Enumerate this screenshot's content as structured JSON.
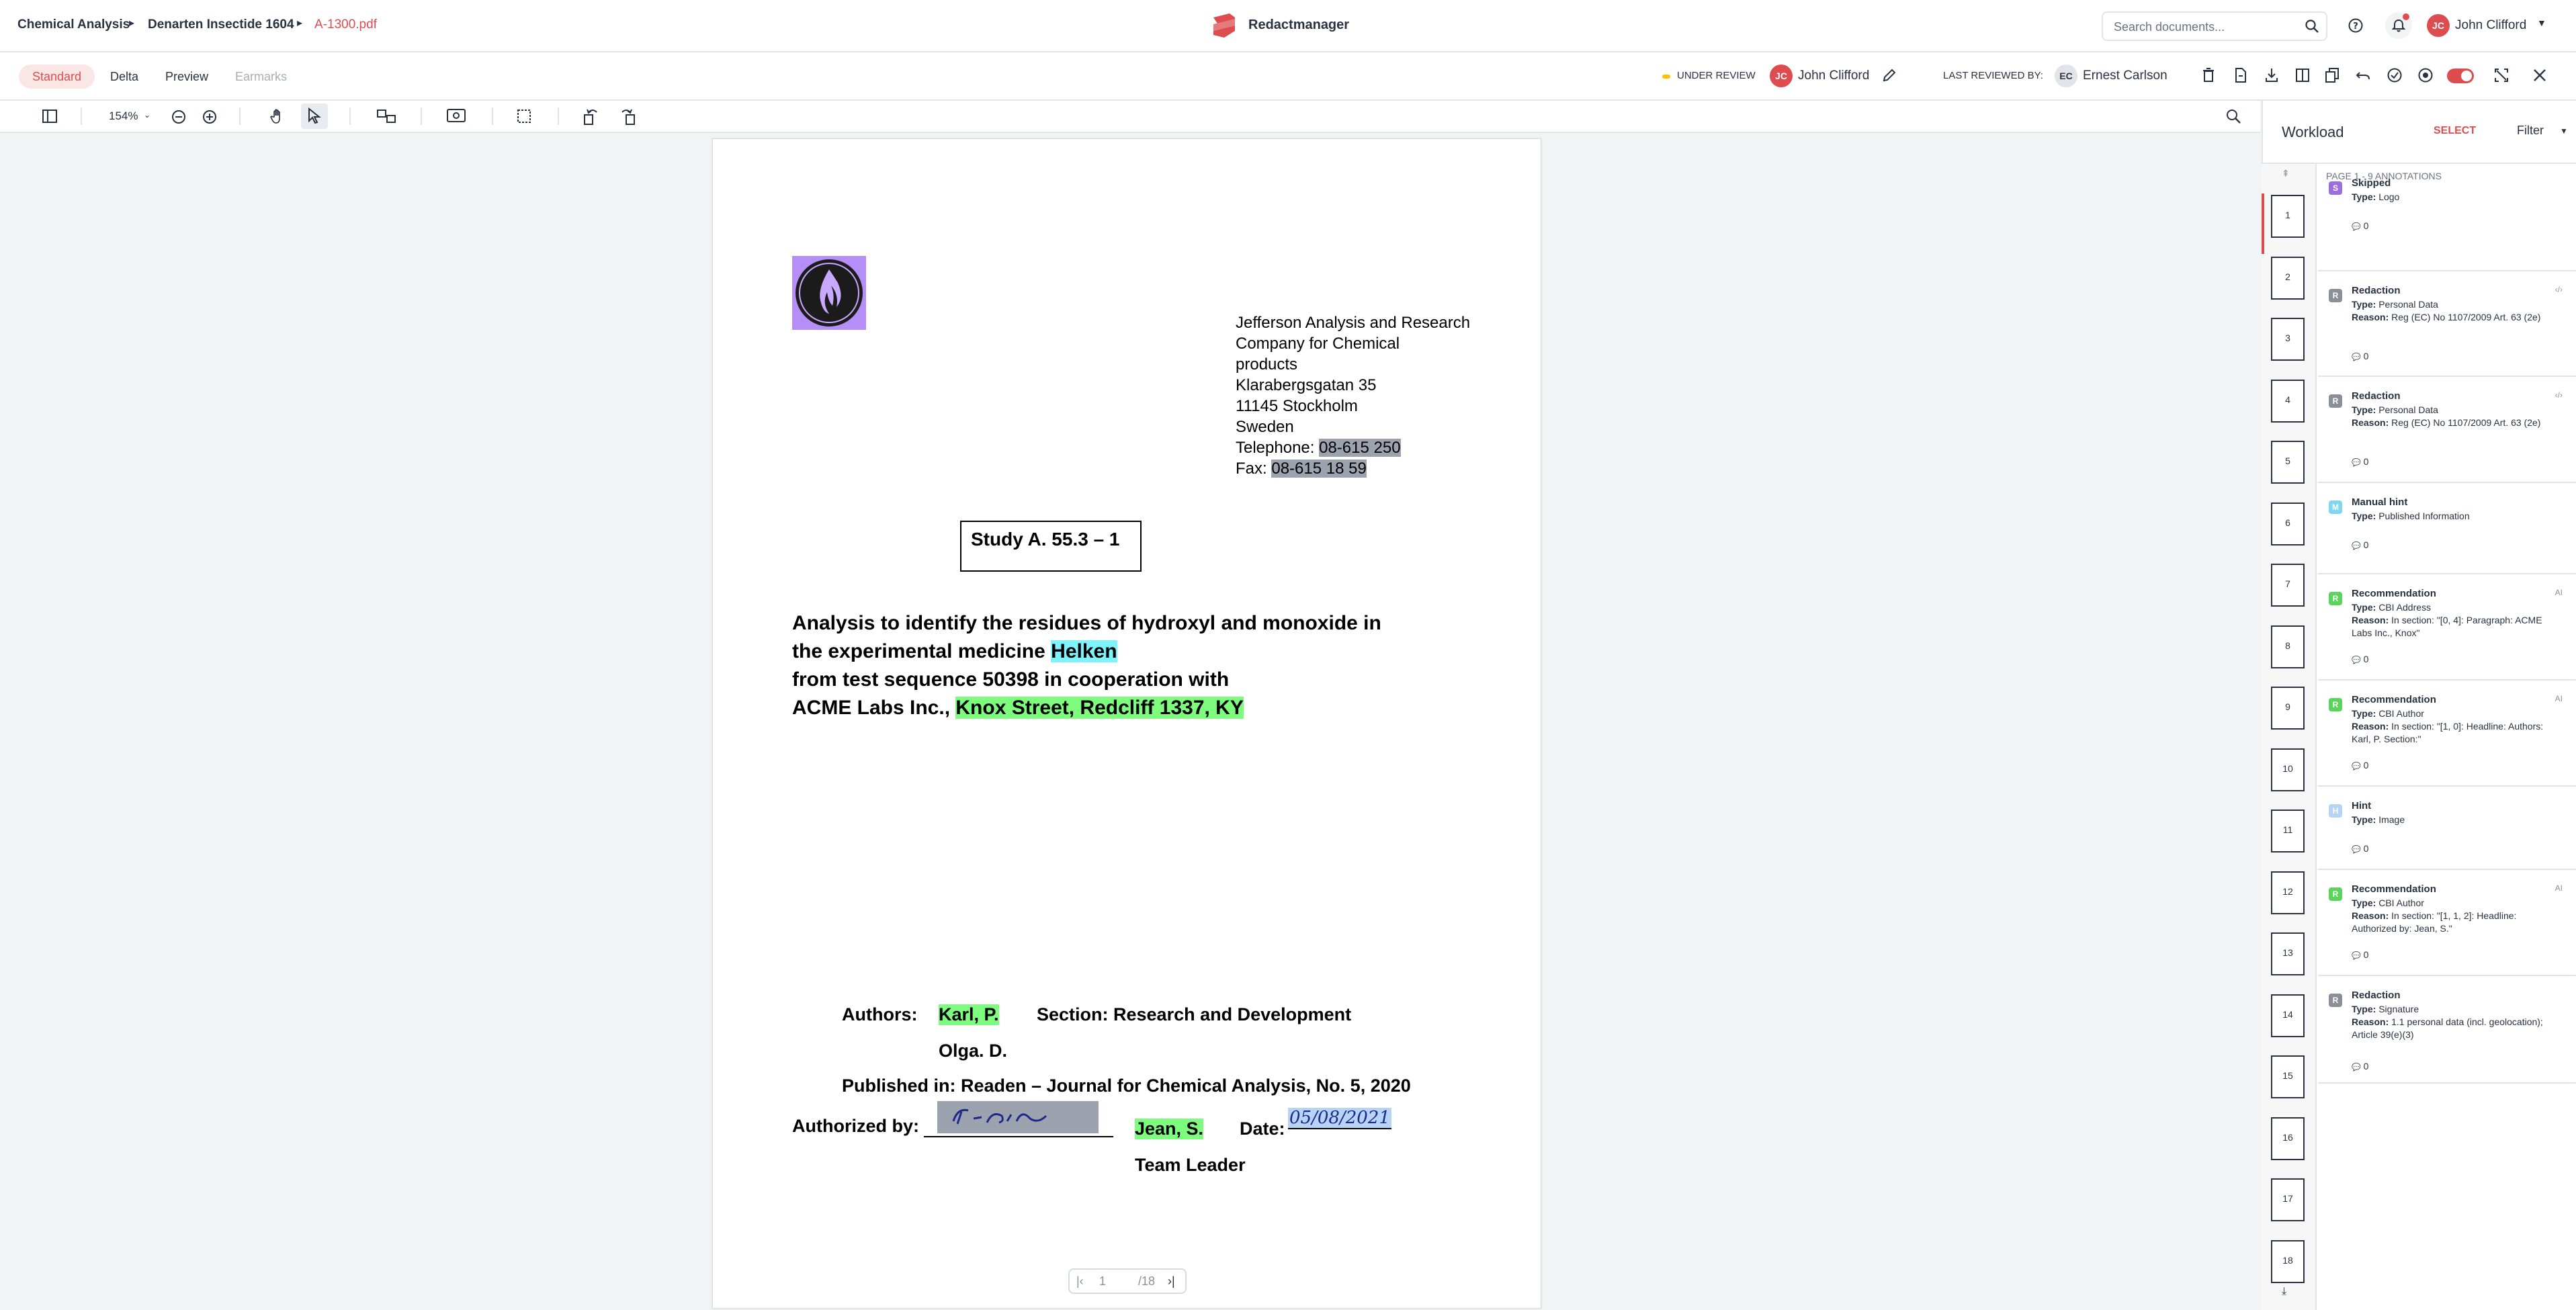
{
  "breadcrumb": {
    "dossier": "Chemical Analysis",
    "folder": "Denarten Insectide 1604",
    "file": "A-1300.pdf"
  },
  "app": {
    "title": "Redactmanager"
  },
  "search": {
    "placeholder": "Search documents..."
  },
  "user": {
    "initials": "JC",
    "name": "John Clifford"
  },
  "tabs": [
    {
      "label": "Standard"
    },
    {
      "label": "Delta"
    },
    {
      "label": "Preview"
    },
    {
      "label": "Earmarks"
    }
  ],
  "review": {
    "status": "UNDER REVIEW",
    "assignee_initials": "JC",
    "assignee": "John Clifford",
    "last_reviewed_label": "LAST REVIEWED BY:",
    "last_reviewer_initials": "EC",
    "last_reviewer": "Ernest Carlson"
  },
  "toolbar": {
    "zoom": "154%"
  },
  "document": {
    "address": [
      "Jefferson Analysis and Research",
      "Company for Chemical",
      "products",
      "Klarabergsgatan 35",
      "11145 Stockholm",
      "Sweden"
    ],
    "telephone_label": "Telephone:",
    "telephone": "08-615 250",
    "fax_label": "Fax:",
    "fax": "08-615 18 59",
    "study_box": "Study A. 55.3 – 1",
    "title_line1": "Analysis to identify the residues of hydroxyl and monoxide in",
    "title_line2_prefix": "the experimental medicine",
    "title_line2_highlight": "Helken",
    "title_line3": "from test sequence 50398 in cooperation with",
    "title_line4_prefix": "ACME Labs Inc.,",
    "title_line4_highlight": "Knox Street, Redcliff 1337, KY",
    "authors_label": "Authors:",
    "author1": "Karl, P.",
    "section": "Section: Research and Development",
    "author2": "Olga. D.",
    "published": "Published in: Readen – Journal for Chemical Analysis, No. 5, 2020",
    "authorized_label": "Authorized by:",
    "authorizer": "Jean, S.",
    "date_label": "Date:",
    "date_value": "05/08/2021",
    "role": "Team Leader"
  },
  "pager": {
    "current": "1",
    "total": "/18"
  },
  "workload": {
    "title": "Workload",
    "select": "SELECT",
    "filter": "Filter",
    "page_heading": "PAGE 1 - 9 ANNOTATIONS"
  },
  "thumbnails": [
    "1",
    "2",
    "3",
    "4",
    "5",
    "6",
    "7",
    "8",
    "9",
    "10",
    "11",
    "12",
    "13",
    "14",
    "15",
    "16",
    "17",
    "18"
  ],
  "annotations": [
    {
      "badge": "S",
      "color": "#9b6ddf",
      "title": "Skipped",
      "type": "Logo",
      "reason": "",
      "count": "0",
      "tag": ""
    },
    {
      "badge": "R",
      "color": "#8a8f98",
      "title": "Redaction",
      "type": "Personal Data",
      "reason": "Reg (EC) No 1107/2009 Art. 63 (2e)",
      "count": "0",
      "tag": "‹/›"
    },
    {
      "badge": "R",
      "color": "#8a8f98",
      "title": "Redaction",
      "type": "Personal Data",
      "reason": "Reg (EC) No 1107/2009 Art. 63 (2e)",
      "count": "0",
      "tag": "‹/›"
    },
    {
      "badge": "M",
      "color": "#7fd8f0",
      "title": "Manual hint",
      "type": "Published Information",
      "reason": "",
      "count": "0",
      "tag": ""
    },
    {
      "badge": "R",
      "color": "#5bd45b",
      "title": "Recommendation",
      "type": "CBI Address",
      "reason": "In section: \"[0, 4]: Paragraph: ACME Labs Inc., Knox\"",
      "count": "0",
      "tag": "AI"
    },
    {
      "badge": "R",
      "color": "#5bd45b",
      "title": "Recommendation",
      "type": "CBI Author",
      "reason": "In section: \"[1, 0]: Headline: Authors: Karl, P. Section:\"",
      "count": "0",
      "tag": "AI"
    },
    {
      "badge": "H",
      "color": "#b7d3f5",
      "title": "Hint",
      "type": "Image",
      "reason": "",
      "count": "0",
      "tag": ""
    },
    {
      "badge": "R",
      "color": "#5bd45b",
      "title": "Recommendation",
      "type": "CBI Author",
      "reason": "In section: \"[1, 1, 2]: Headline: Authorized by: Jean, S.\"",
      "count": "0",
      "tag": "AI"
    },
    {
      "badge": "R",
      "color": "#8a8f98",
      "title": "Redaction",
      "type": "Signature",
      "reason": "1.1 personal data (incl. geolocation); Article 39(e)(3)",
      "count": "0",
      "tag": ""
    }
  ],
  "labels": {
    "type": "Type:",
    "reason": "Reason:"
  },
  "colors": {
    "accent": "#dd4d50",
    "status": "#fdbd00",
    "redact_gray": "#9ca3af",
    "recommend_green": "#7dfc7d",
    "hint_cyan": "#7df3fb"
  }
}
